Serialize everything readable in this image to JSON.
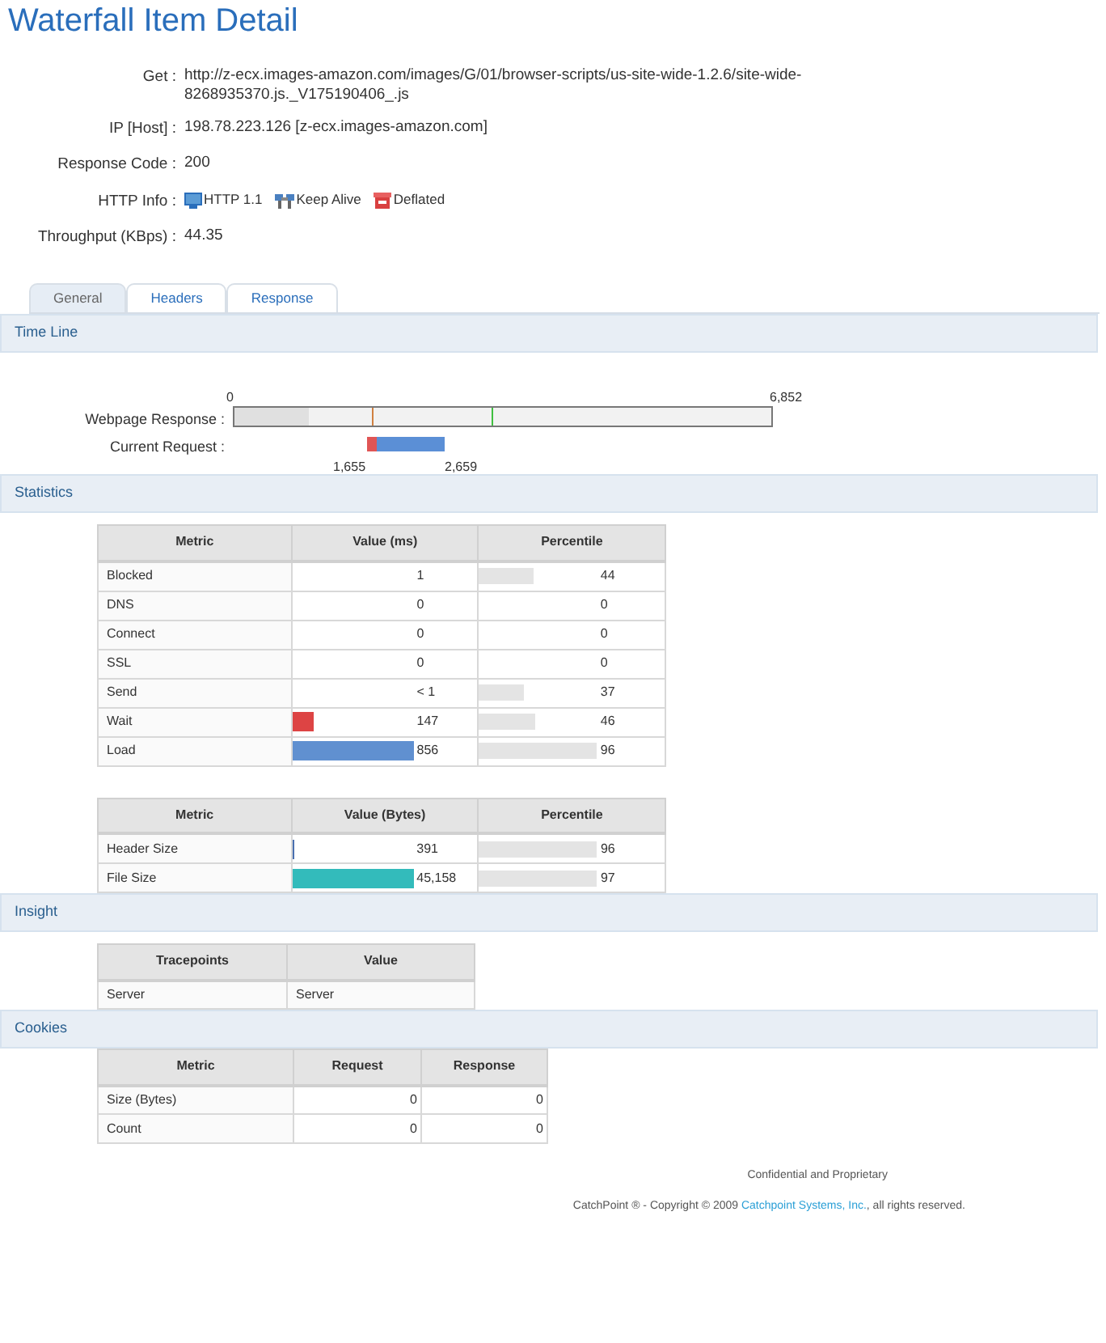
{
  "title": "Waterfall Item Detail",
  "info": [
    {
      "kind": "text",
      "label": "Get :",
      "value": "http://z-ecx.images-amazon.com/images/G/01/browser-scripts/us-site-wide-1.2.6/site-wide-8268935370.js._V175190406_.js"
    },
    {
      "kind": "text",
      "label": "IP [Host] :",
      "value": "198.78.223.126 [z-ecx.images-amazon.com]"
    },
    {
      "kind": "text",
      "label": "Response Code :",
      "value": "200"
    },
    {
      "kind": "badges",
      "label": "HTTP Info :",
      "badges": [
        "HTTP 1.1",
        "Keep Alive",
        "Deflated"
      ]
    },
    {
      "kind": "text",
      "label": "Throughput (KBps) :",
      "value": "44.35"
    }
  ],
  "tabs": [
    {
      "label": "General",
      "selected": true
    },
    {
      "label": "Headers",
      "selected": false
    },
    {
      "label": "Response",
      "selected": false
    }
  ],
  "timeline": {
    "heading": "Time Line",
    "rows": [
      "Webpage Response :",
      "Current Request :"
    ],
    "start": "0",
    "end": "6,852",
    "request_start": "1,655",
    "request_end": "2,659"
  },
  "statistics": {
    "heading": "Statistics",
    "tables": [
      {
        "columns": [
          "Metric",
          "Value (ms)",
          "Percentile"
        ],
        "rows": [
          {
            "metric": "Blocked",
            "value": "1",
            "percentile": "44",
            "percentile_bar": {
              "level": 0.29
            }
          },
          {
            "metric": "DNS",
            "value": "0",
            "percentile": "0"
          },
          {
            "metric": "Connect",
            "value": "0",
            "percentile": "0"
          },
          {
            "metric": "SSL",
            "value": "0",
            "percentile": "0"
          },
          {
            "metric": "Send",
            "value": "< 1",
            "percentile": "37",
            "percentile_bar": {
              "level": 0.24
            }
          },
          {
            "metric": "Wait",
            "value": "147",
            "value_bar": {
              "level": 0.11,
              "color": "#dd4444"
            },
            "percentile": "46",
            "percentile_bar": {
              "level": 0.3
            }
          },
          {
            "metric": "Load",
            "value": "856",
            "value_bar": {
              "level": 0.65,
              "color": "#6090d0"
            },
            "percentile": "96",
            "percentile_bar": {
              "level": 0.63
            }
          }
        ]
      },
      {
        "columns": [
          "Metric",
          "Value (Bytes)",
          "Percentile"
        ],
        "rows": [
          {
            "metric": "Header Size",
            "value": "391",
            "value_bar": {
              "level": 0.01,
              "color": "#4a70b0"
            },
            "percentile": "96",
            "percentile_bar": {
              "level": 0.63
            }
          },
          {
            "metric": "File Size",
            "value": "45,158",
            "value_bar": {
              "level": 0.65,
              "color": "#33bbbb"
            },
            "percentile": "97",
            "percentile_bar": {
              "level": 0.63
            }
          }
        ]
      }
    ]
  },
  "insight": {
    "heading": "Insight",
    "columns": [
      "Tracepoints",
      "Value"
    ],
    "rows": [
      [
        "Server",
        "Server"
      ]
    ]
  },
  "cookies": {
    "heading": "Cookies",
    "columns": [
      "Metric",
      "Request",
      "Response"
    ],
    "rows": [
      [
        "Size (Bytes)",
        "0",
        "0"
      ],
      [
        "Count",
        "0",
        "0"
      ]
    ]
  },
  "footer": {
    "line_1": "Confidential and Proprietary",
    "copyright_before": "CatchPoint ® - Copyright © 2009 ",
    "link": "Catchpoint Systems, Inc.",
    "copyright_after": ", all rights reserved."
  }
}
